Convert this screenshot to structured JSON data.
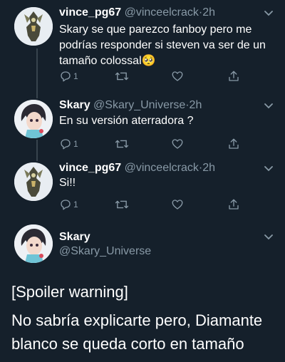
{
  "tweets": [
    {
      "name": "vince_pg67",
      "handle": "@vinceelcrack",
      "separator": "·",
      "time": "2h",
      "lines": [
        "Skary se que parezco fanboy pero me",
        "podrías responder si steven va  ser de un",
        "tamaño colossal🥺"
      ],
      "reply_count": "1",
      "avatar": "armored-character-avatar"
    },
    {
      "name": "Skary",
      "handle": "@Skary_Universe",
      "separator": "·",
      "time": "2h",
      "lines": [
        "En su versión aterradora ?"
      ],
      "reply_count": "1",
      "avatar": "anime-girl-avatar"
    },
    {
      "name": "vince_pg67",
      "handle": "@vinceelcrack",
      "separator": "·",
      "time": "2h",
      "lines": [
        "Si!!"
      ],
      "reply_count": "1",
      "avatar": "armored-character-avatar"
    }
  ],
  "focused_tweet": {
    "name": "Skary",
    "handle": "@Skary_Universe",
    "lines": [
      "[Spoiler warning]",
      "No sabría explicarte  pero, Diamante",
      "blanco se queda corto en tamaño"
    ]
  },
  "icons": {
    "reply": "reply-icon",
    "retweet": "retweet-icon",
    "like": "heart-icon",
    "share": "share-icon",
    "menu": "chevron-down-icon"
  },
  "colors": {
    "background": "#15202b",
    "secondary_text": "#8899a6",
    "thread_line": "#38444d"
  }
}
